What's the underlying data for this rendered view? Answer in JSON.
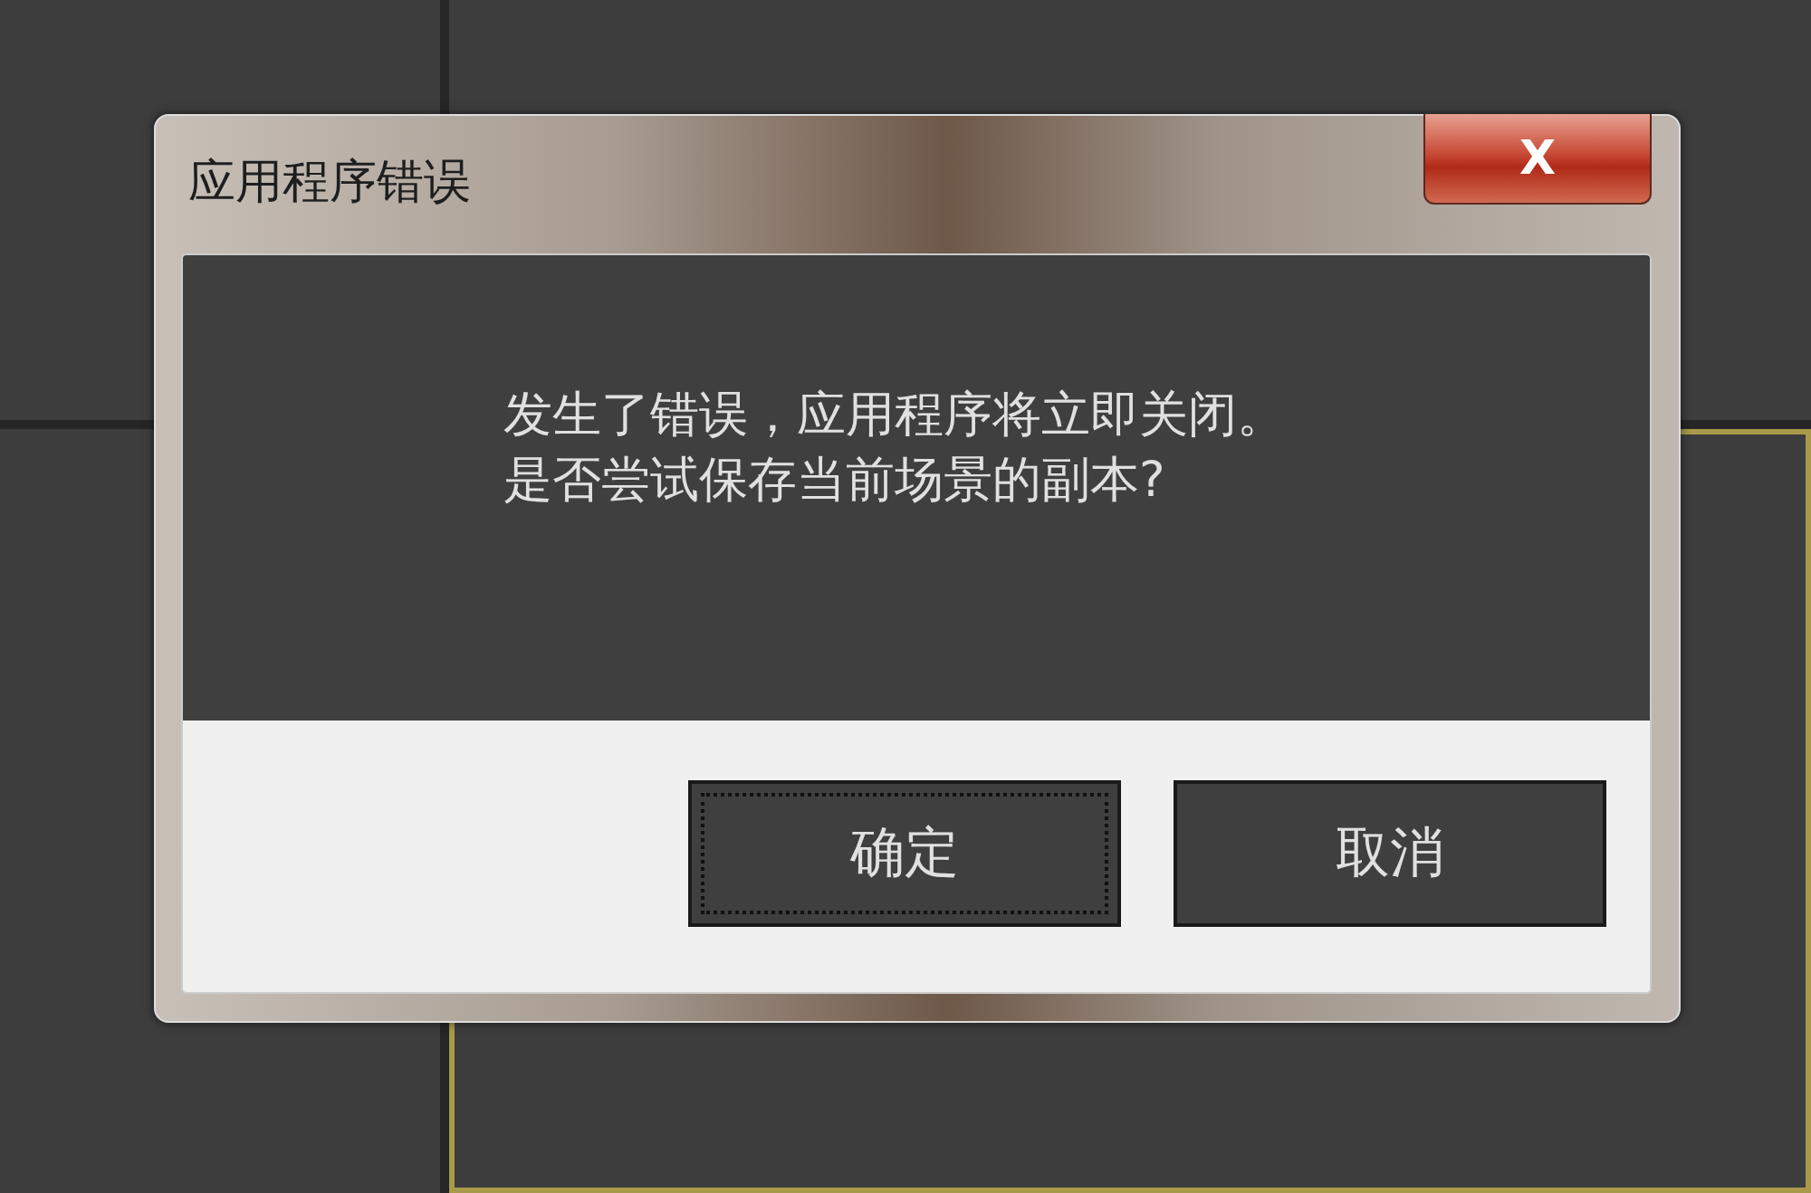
{
  "dialog": {
    "title": "应用程序错误",
    "close": "X",
    "message_lines": [
      "发生了错误，应用程序将立即关闭。",
      "是否尝试保存当前场景的副本?"
    ],
    "buttons": [
      {
        "label": "确定",
        "focused": true
      },
      {
        "label": "取消",
        "focused": false
      }
    ]
  },
  "viewports": [
    {
      "active": false
    },
    {
      "active": false
    },
    {
      "active": false
    },
    {
      "active": true
    }
  ]
}
